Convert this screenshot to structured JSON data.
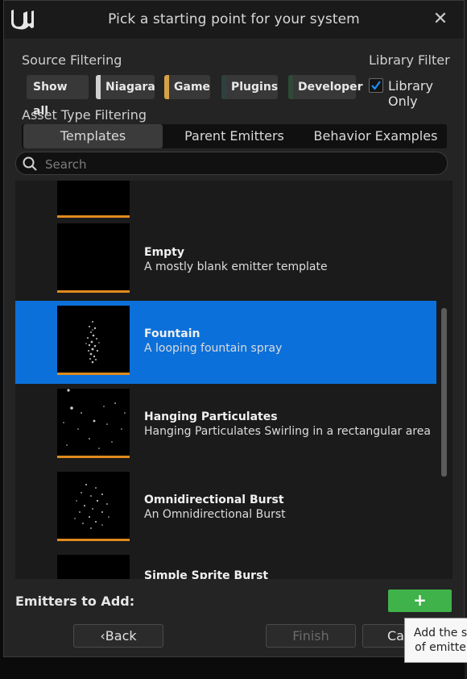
{
  "window": {
    "title": "Pick a starting point for your system"
  },
  "source_filtering": {
    "label": "Source Filtering",
    "chips": [
      {
        "label": "Show all",
        "color": null
      },
      {
        "label": "Niagara",
        "color": "#cfcfcf"
      },
      {
        "label": "Game",
        "color": "#d6a146"
      },
      {
        "label": "Plugins",
        "color": "#2f4040"
      },
      {
        "label": "Developer",
        "color": "#2f4a35"
      }
    ]
  },
  "library_filter": {
    "label": "Library Filter",
    "checkbox_label": "Library Only",
    "checked": true
  },
  "asset_type": {
    "label": "Asset Type Filtering",
    "tabs": [
      "Templates",
      "Parent Emitters",
      "Behavior Examples"
    ],
    "active_tab": "Templates"
  },
  "search": {
    "placeholder": "Search",
    "value": ""
  },
  "items": [
    {
      "title": "",
      "description": ""
    },
    {
      "title": "Empty",
      "description": "A mostly blank emitter template"
    },
    {
      "title": "Fountain",
      "description": "A looping fountain spray",
      "selected": true
    },
    {
      "title": "Hanging Particulates",
      "description": "Hanging Particulates Swirling in a rectangular area"
    },
    {
      "title": "Omnidirectional Burst",
      "description": "An Omnidirectional Burst"
    },
    {
      "title": "Simple Sprite Burst",
      "description": ""
    }
  ],
  "footer": {
    "emitters_label": "Emitters to Add:",
    "add_label": "+",
    "back_label": "Back",
    "finish_label": "Finish",
    "cancel_label": "Car"
  },
  "tooltip": {
    "line1": "Add the s",
    "line2": "of emitte"
  },
  "colors": {
    "accent_selected": "#0c70da",
    "add_green": "#3fb24a",
    "thumb_underline": "#e08a1e"
  }
}
